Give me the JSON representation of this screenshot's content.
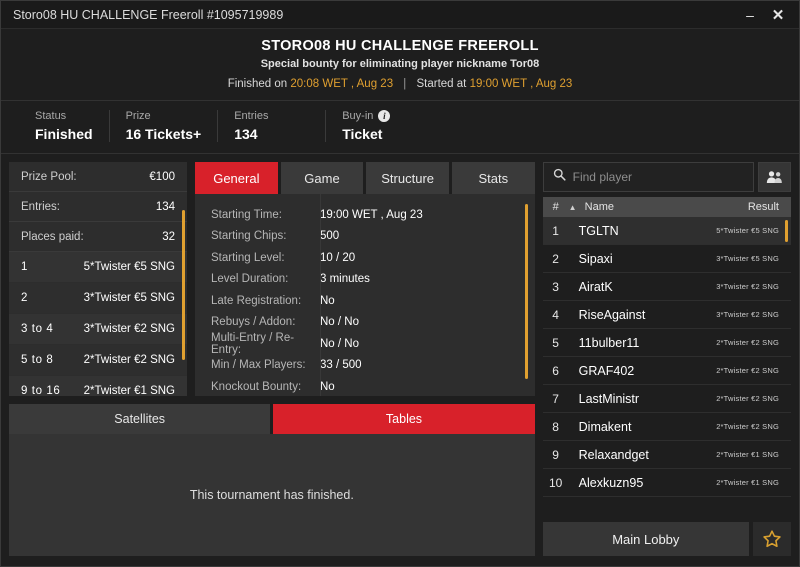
{
  "window": {
    "title": "Storo08 HU CHALLENGE Freeroll #1095719989",
    "minimize_label": "–",
    "close_label": "✕"
  },
  "header": {
    "title": "STORO08 HU CHALLENGE FREEROLL",
    "subtitle": "Special bounty for eliminating player nickname Tor08",
    "finished_prefix": "Finished on",
    "finished_time": "20:08 WET , Aug 23",
    "separator": "|",
    "started_prefix": "Started at",
    "started_time": "19:00 WET , Aug 23"
  },
  "status": {
    "items": [
      {
        "label": "Status",
        "value": "Finished"
      },
      {
        "label": "Prize",
        "value": "16 Tickets+"
      },
      {
        "label": "Entries",
        "value": "134"
      },
      {
        "label": "Buy-in",
        "value": "Ticket",
        "icon": "info-icon"
      }
    ]
  },
  "prize_panel": {
    "summary": [
      {
        "label": "Prize Pool:",
        "value": "€100"
      },
      {
        "label": "Entries:",
        "value": "134"
      },
      {
        "label": "Places paid:",
        "value": "32"
      }
    ],
    "places": [
      {
        "rank": "1",
        "prize": "5*Twister €5 SNG"
      },
      {
        "rank": "2",
        "prize": "3*Twister €5 SNG"
      },
      {
        "rank": "3 to 4",
        "prize": "3*Twister €2 SNG"
      },
      {
        "rank": "5 to 8",
        "prize": "2*Twister €2 SNG"
      },
      {
        "rank": "9 to 16",
        "prize": "2*Twister €1 SNG"
      }
    ]
  },
  "tabs": {
    "items": [
      {
        "label": "General",
        "active": true
      },
      {
        "label": "Game",
        "active": false
      },
      {
        "label": "Structure",
        "active": false
      },
      {
        "label": "Stats",
        "active": false
      }
    ]
  },
  "general": {
    "rows": [
      {
        "key": "Starting Time:",
        "value": "19:00 WET , Aug 23"
      },
      {
        "key": "Starting Chips:",
        "value": "500"
      },
      {
        "key": "Starting Level:",
        "value": "10 / 20"
      },
      {
        "key": "Level Duration:",
        "value": "3 minutes"
      },
      {
        "key": "Late Registration:",
        "value": "No"
      },
      {
        "key": "Rebuys / Addon:",
        "value": "No / No"
      },
      {
        "key": "Multi-Entry / Re-Entry:",
        "value": "No / No"
      },
      {
        "key": "Min / Max Players:",
        "value": "33 / 500"
      },
      {
        "key": "Knockout Bounty:",
        "value": "No"
      }
    ]
  },
  "lower_tabs": {
    "items": [
      {
        "label": "Satellites",
        "active": false
      },
      {
        "label": "Tables",
        "active": true
      }
    ],
    "message": "This tournament has finished."
  },
  "players": {
    "search_placeholder": "Find player",
    "search_value": "",
    "columns": {
      "num": "#",
      "sort": "▲",
      "name": "Name",
      "result": "Result"
    },
    "rows": [
      {
        "num": "1",
        "name": "TGLTN",
        "result": "5*Twister €5 SNG",
        "selected": true
      },
      {
        "num": "2",
        "name": "Sipaxi",
        "result": "3*Twister €5 SNG",
        "selected": false
      },
      {
        "num": "3",
        "name": "AiratK",
        "result": "3*Twister €2 SNG",
        "selected": false
      },
      {
        "num": "4",
        "name": "RiseAgainst",
        "result": "3*Twister €2 SNG",
        "selected": false
      },
      {
        "num": "5",
        "name": "11bulber11",
        "result": "2*Twister €2 SNG",
        "selected": false
      },
      {
        "num": "6",
        "name": "GRAF402",
        "result": "2*Twister €2 SNG",
        "selected": false
      },
      {
        "num": "7",
        "name": "LastMinistr",
        "result": "2*Twister €2 SNG",
        "selected": false
      },
      {
        "num": "8",
        "name": "Dimakent",
        "result": "2*Twister €2 SNG",
        "selected": false
      },
      {
        "num": "9",
        "name": "Relaxandget",
        "result": "2*Twister €1 SNG",
        "selected": false
      },
      {
        "num": "10",
        "name": "Alexkuzn95",
        "result": "2*Twister €1 SNG",
        "selected": false
      }
    ]
  },
  "footer": {
    "main_lobby_label": "Main Lobby",
    "favorite_icon": "star-icon"
  },
  "colors": {
    "accent_red": "#d8212a",
    "accent_gold": "#e0a030",
    "panel": "#2d2d2d",
    "background": "#1e1e1e"
  }
}
